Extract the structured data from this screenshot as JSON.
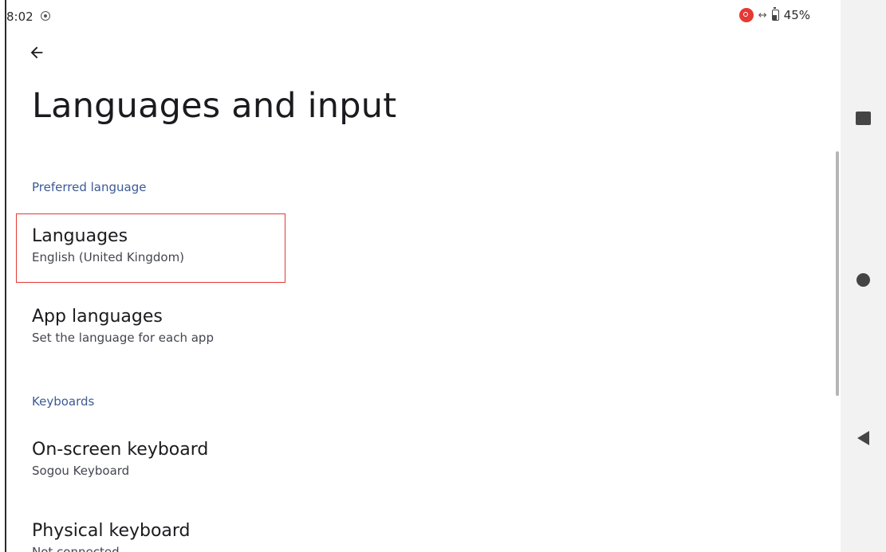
{
  "status_bar": {
    "time": "8:02",
    "battery": "45%"
  },
  "header": {
    "title": "Languages and input"
  },
  "sections": [
    {
      "header": "Preferred language",
      "items": [
        {
          "title": "Languages",
          "subtitle": "English (United Kingdom)"
        },
        {
          "title": "App languages",
          "subtitle": "Set the language for each app"
        }
      ]
    },
    {
      "header": "Keyboards",
      "items": [
        {
          "title": "On-screen keyboard",
          "subtitle": "Sogou Keyboard"
        },
        {
          "title": "Physical keyboard",
          "subtitle": "Not connected"
        }
      ]
    }
  ],
  "icons": {
    "back": "back-arrow-icon",
    "nav_recents": "square-icon",
    "nav_home": "circle-icon",
    "nav_back": "triangle-back-icon"
  },
  "colors": {
    "section_header": "#3b5a95",
    "highlight": "#e53935",
    "nav_bar_bg": "#f2f2f2"
  }
}
